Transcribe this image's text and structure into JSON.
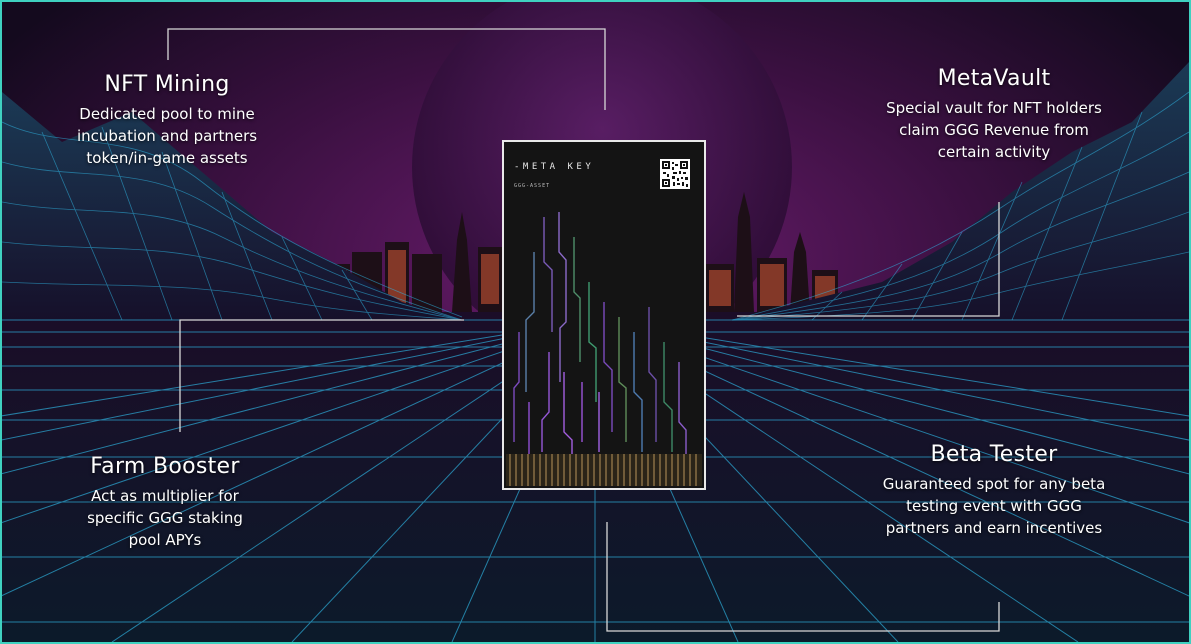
{
  "features": {
    "nft_mining": {
      "title": "NFT Mining",
      "description": "Dedicated pool to mine\nincubation and partners\ntoken/in-game assets"
    },
    "metavault": {
      "title": "MetaVault",
      "description": "Special vault for NFT holders\nclaim GGG Revenue from\ncertain activity"
    },
    "farm_booster": {
      "title": "Farm Booster",
      "description": "Act as multiplier for\nspecific GGG staking\npool APYs"
    },
    "beta_tester": {
      "title": "Beta Tester",
      "description": "Guaranteed spot for any beta\ntesting event with GGG\npartners and earn incentives"
    }
  },
  "card": {
    "title": "-META KEY",
    "subtitle": "GGG-ASSET"
  },
  "colors": {
    "frame_border": "#3fd1c0",
    "sky_top": "#140a1e",
    "sky_glow": "#6b1c6e",
    "grid_line": "#2fb8e6",
    "connector_line": "#d8d8d8",
    "card_border": "#e9e9e9",
    "city_window": "#ff6a3d"
  },
  "icons": {
    "card_qr": "qr-code-icon"
  }
}
